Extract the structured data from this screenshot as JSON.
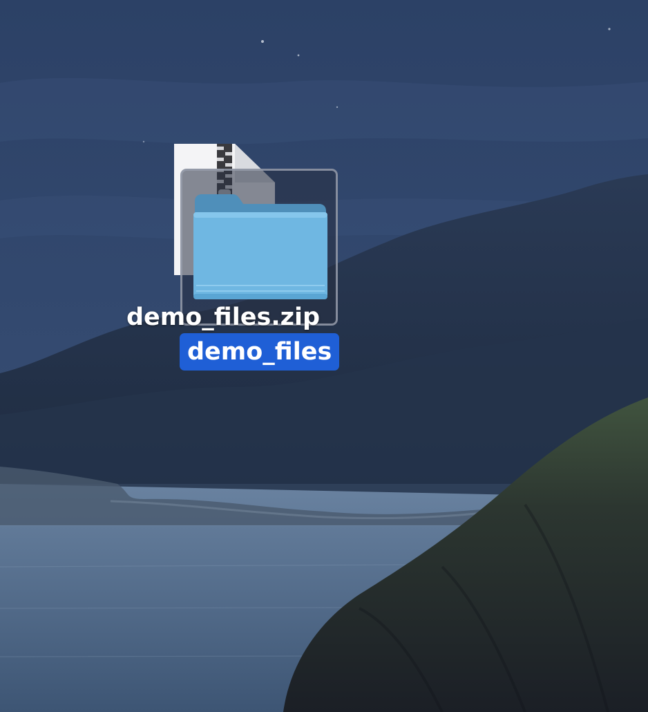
{
  "desktop": {
    "icons": [
      {
        "label": "demo_files.zip",
        "icon": "zip-archive-icon",
        "selected": false
      },
      {
        "label": "demo_files",
        "icon": "folder-icon",
        "selected": true
      }
    ]
  },
  "colors": {
    "selection_highlight": "#1f5fd6",
    "folder_body": "#6fb7e2",
    "folder_tab": "#4f8fba"
  }
}
